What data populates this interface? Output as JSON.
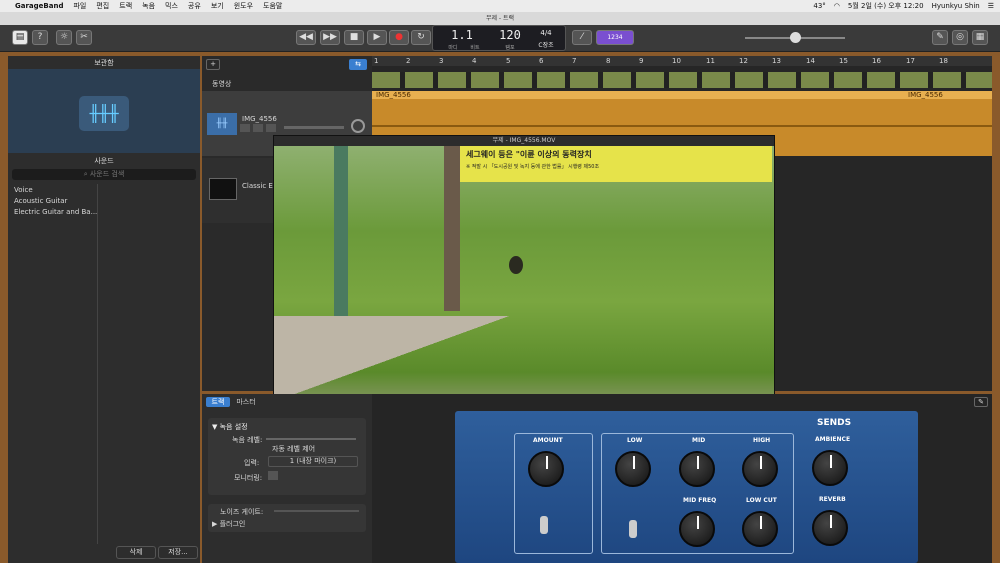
{
  "menubar": {
    "apple": "",
    "app": "GarageBand",
    "items": [
      "파일",
      "편집",
      "트랙",
      "녹음",
      "믹스",
      "공유",
      "보기",
      "윈도우",
      "도움말"
    ],
    "battery": "43°",
    "date": "5월 2일 (수) 오후 12:20",
    "user": "Hyunkyu Shin"
  },
  "window": {
    "title": "무제 - 트랙"
  },
  "lcd": {
    "bar": "1",
    "beat": "1",
    "tempo": "120",
    "signature": "4/4",
    "key": "C장조",
    "bar_label": "마디",
    "beat_label": "비트",
    "tempo_label": "템포"
  },
  "toolbar": {
    "count_in": "1234"
  },
  "library": {
    "title": "보관함",
    "sounds_title": "사운드",
    "search_placeholder": "사운드 검색",
    "items": [
      "Voice",
      "Acoustic Guitar",
      "Electric Guitar and Ba..."
    ],
    "delete_button": "삭제",
    "save_button": "저장..."
  },
  "tracks": {
    "add": "+",
    "movie_label": "동영상",
    "track1": "IMG_4556",
    "track2": "Classic El",
    "region_label": "IMG_4556",
    "region_label2": "IMG_4556",
    "ruler": [
      "1",
      "2",
      "3",
      "4",
      "5",
      "6",
      "7",
      "8",
      "9",
      "10",
      "11",
      "12",
      "13",
      "14",
      "15",
      "16",
      "17",
      "18"
    ]
  },
  "video": {
    "title": "무제 - IMG_4556.MOV",
    "banner": "세그웨이 등은 \"이륜 이상의 동력장치",
    "banner2": "※ 적발 시 「도시공원 및 녹지 등에 관한 법률」 시행령 제50조"
  },
  "inspector": {
    "tab_track": "트랙",
    "tab_master": "마스터",
    "section": "▼ 녹음 설정",
    "record_level": "녹음 레벨:",
    "auto_level": "자동 레벨 제어",
    "input": "입력:",
    "input_value": "1 (내장 마이크)",
    "monitoring": "모니터링:",
    "noise_gate": "노이즈 게이트:",
    "plugins": "▶ 플러그인"
  },
  "amp": {
    "sends": "SENDS",
    "amount": "AMOUNT",
    "low": "LOW",
    "mid": "MID",
    "high": "HIGH",
    "ambience": "AMBIENCE",
    "mid_freq": "MID FREQ",
    "low_cut": "LOW CUT",
    "reverb": "REVERB"
  }
}
